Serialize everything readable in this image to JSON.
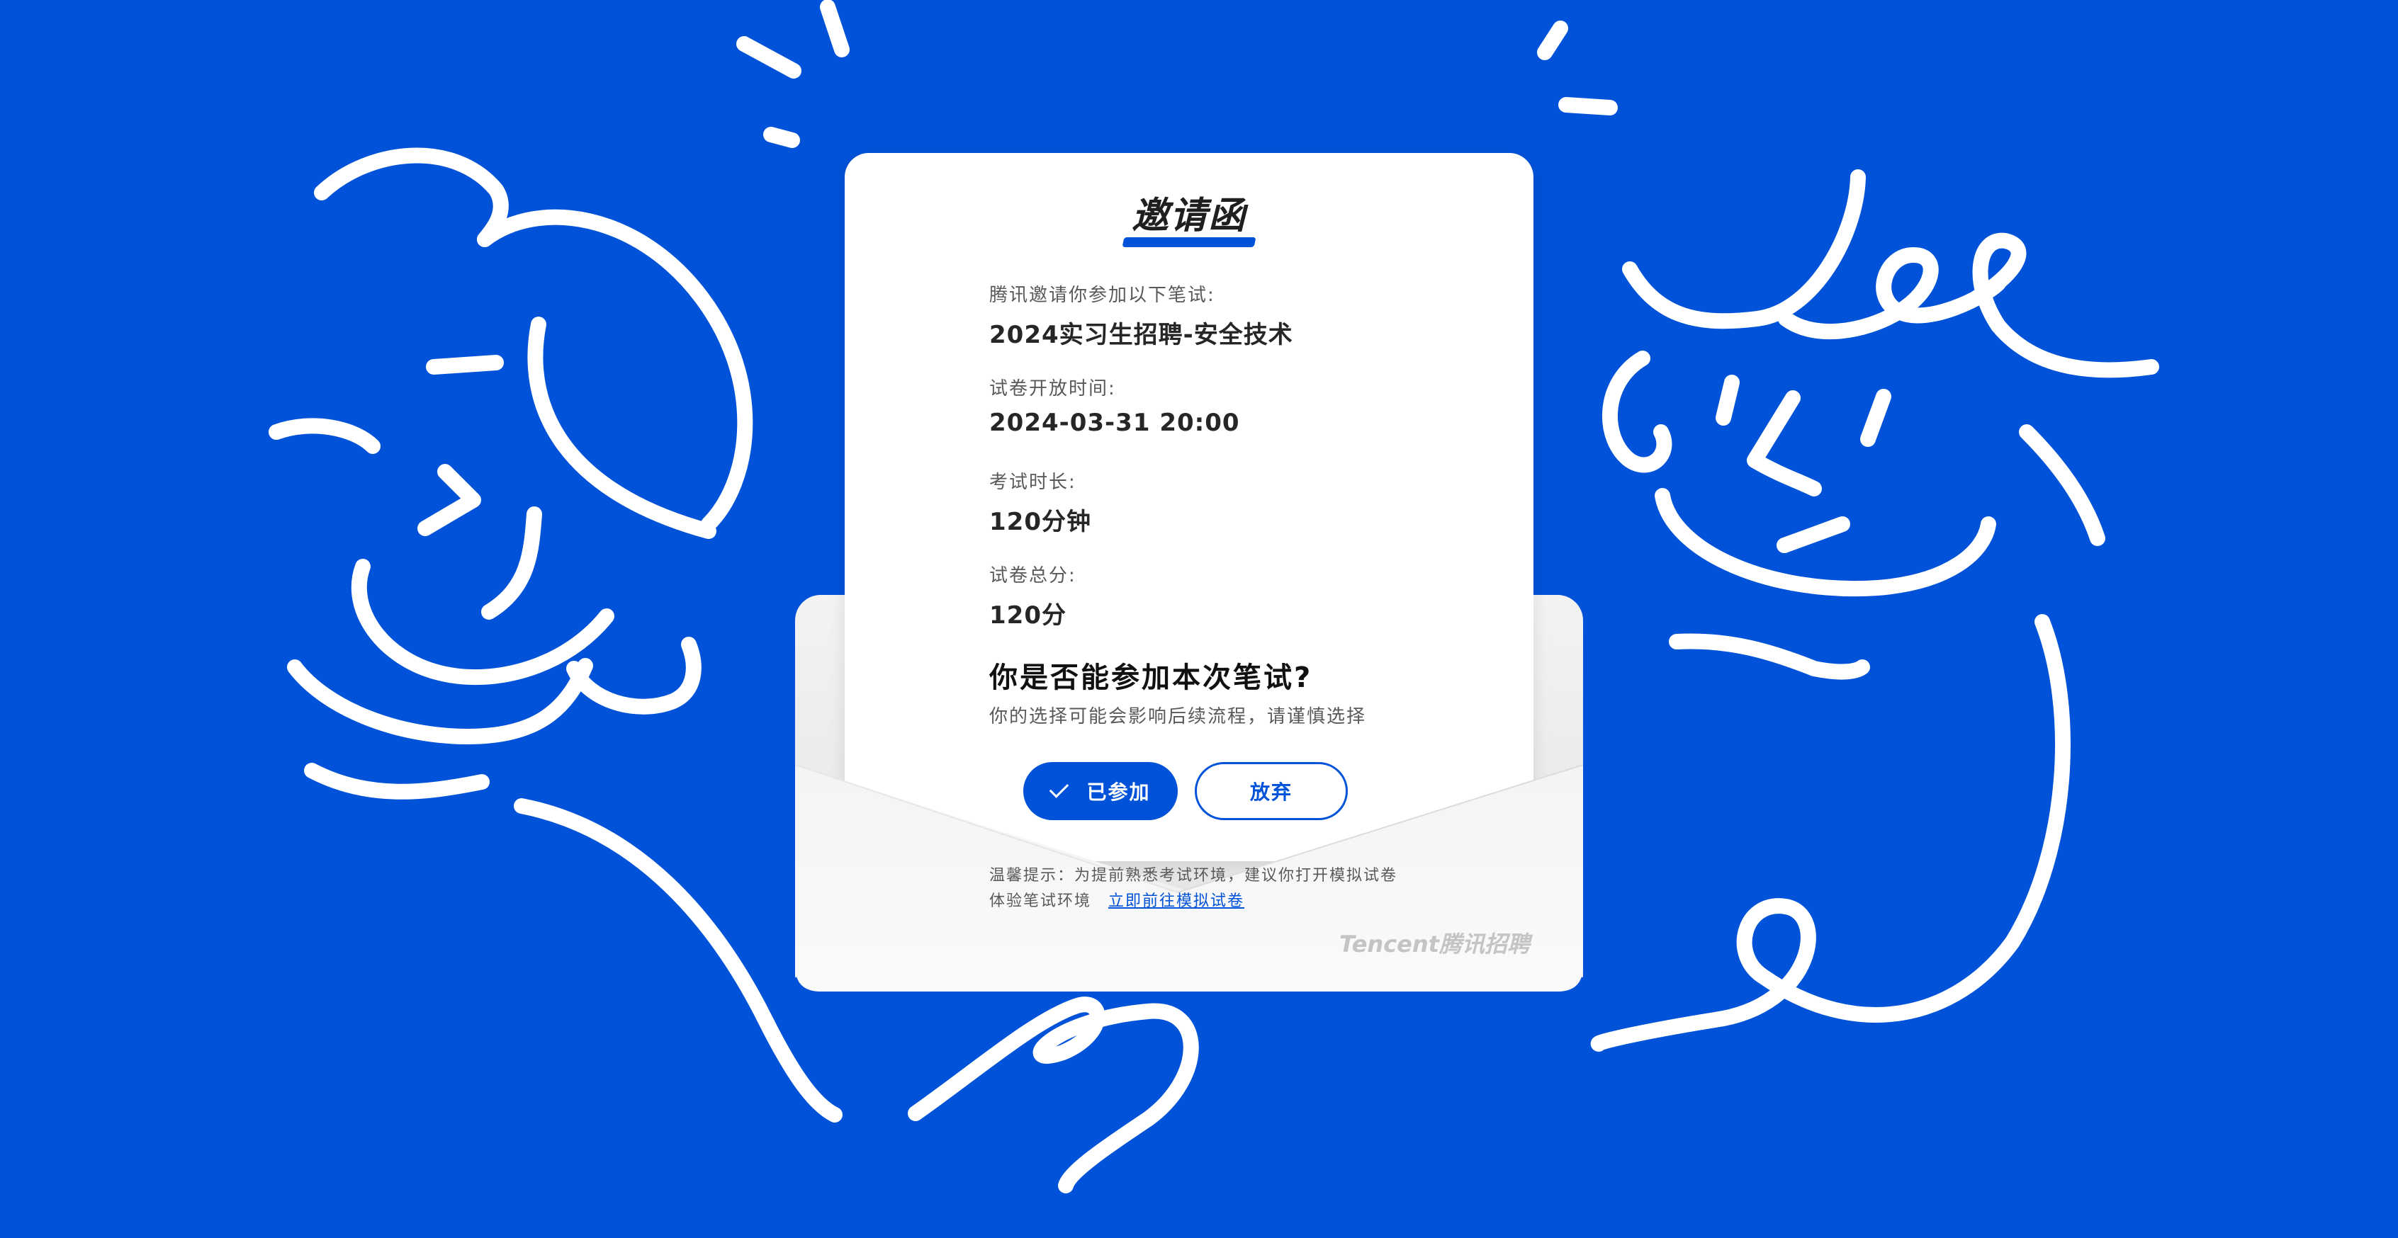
{
  "letter": {
    "title": "邀请函",
    "fields": [
      {
        "label": "腾讯邀请你参加以下笔试:",
        "value": "2024实习生招聘-安全技术"
      },
      {
        "label": "试卷开放时间:",
        "value": "2024-03-31 20:00"
      },
      {
        "label": "考试时长:",
        "value": "120分钟"
      },
      {
        "label": "试卷总分:",
        "value": "120分"
      }
    ],
    "question": "你是否能参加本次笔试?",
    "question_hint": "你的选择可能会影响后续流程，请谨慎选择"
  },
  "actions": {
    "join_label": "已参加",
    "give_up_label": "放弃"
  },
  "tip": {
    "line1": "温馨提示：为提前熟悉考试环境，建议你打开模拟试卷",
    "line2": "体验笔试环境",
    "link_label": "立即前往模拟试卷"
  },
  "brand": {
    "text": "Tencent腾讯招聘"
  },
  "colors": {
    "background": "#0052d9",
    "accent": "#0052d9",
    "card": "#ffffff"
  },
  "icons": [
    "check-icon"
  ]
}
